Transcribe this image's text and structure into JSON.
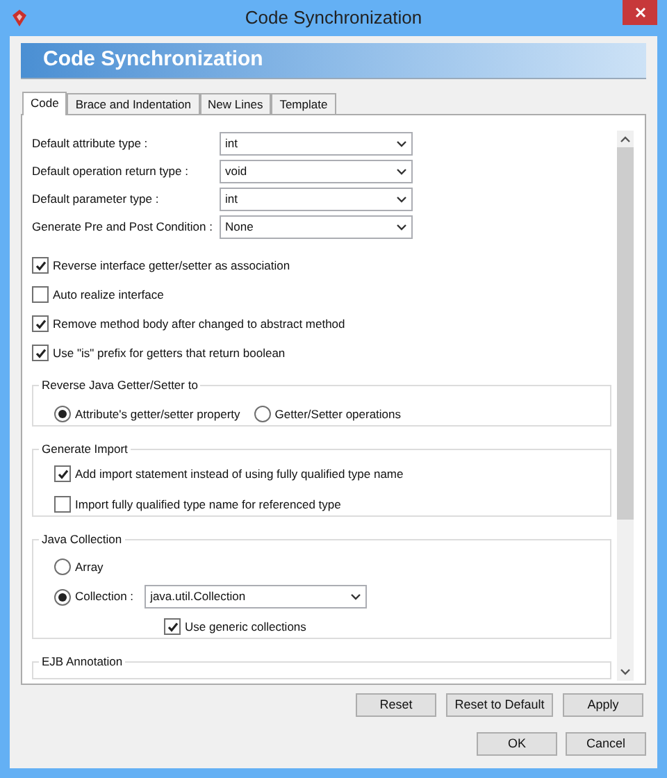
{
  "window": {
    "title": "Code Synchronization"
  },
  "banner": {
    "title": "Code Synchronization"
  },
  "tabs": [
    {
      "label": "Code",
      "selected": true
    },
    {
      "label": "Brace and Indentation",
      "selected": false
    },
    {
      "label": "New Lines",
      "selected": false
    },
    {
      "label": "Template",
      "selected": false
    }
  ],
  "fields": [
    {
      "label": "Default attribute type :",
      "value": "int"
    },
    {
      "label": "Default operation return type :",
      "value": "void"
    },
    {
      "label": "Default parameter type :",
      "value": "int"
    },
    {
      "label": "Generate Pre and Post Condition :",
      "value": "None"
    }
  ],
  "checkboxes": [
    {
      "label": "Reverse interface getter/setter as association",
      "checked": true
    },
    {
      "label": "Auto realize interface",
      "checked": false
    },
    {
      "label": "Remove method body after changed to abstract method",
      "checked": true
    },
    {
      "label": "Use \"is\" prefix for getters that return boolean",
      "checked": true
    }
  ],
  "reverse_getter_setter": {
    "title": "Reverse Java Getter/Setter to",
    "options": [
      {
        "label": "Attribute's getter/setter property",
        "selected": true
      },
      {
        "label": "Getter/Setter operations",
        "selected": false
      }
    ]
  },
  "generate_import": {
    "title": "Generate Import",
    "checkboxes": [
      {
        "label": "Add import statement instead of using fully qualified type name",
        "checked": true
      },
      {
        "label": "Import fully qualified type name for referenced type",
        "checked": false
      }
    ]
  },
  "java_collection": {
    "title": "Java Collection",
    "options": [
      {
        "label": "Array",
        "selected": false
      },
      {
        "label": "Collection :",
        "selected": true
      }
    ],
    "collection_value": "java.util.Collection",
    "generic": {
      "label": "Use generic collections",
      "checked": true
    }
  },
  "ejb_annotation": {
    "title": "EJB Annotation"
  },
  "action_buttons": [
    "Reset",
    "Reset to Default",
    "Apply"
  ],
  "dialog_buttons": [
    "OK",
    "Cancel"
  ]
}
